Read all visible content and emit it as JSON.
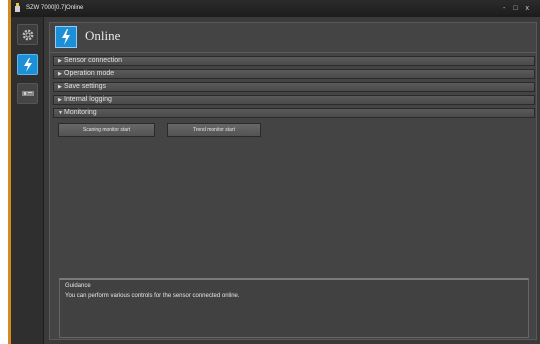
{
  "window": {
    "title": "SZW 7000[0.7]Online",
    "controls": [
      "-",
      "□",
      "x"
    ]
  },
  "rail": {
    "items": [
      {
        "name": "settings",
        "icon": "gear-icon"
      },
      {
        "name": "online",
        "icon": "lightning-icon",
        "active": true
      },
      {
        "name": "sensor",
        "icon": "sensor-device-icon"
      }
    ]
  },
  "header": {
    "title": "Online",
    "icon": "lightning-icon"
  },
  "sections": [
    {
      "label": "Sensor connection",
      "expanded": false
    },
    {
      "label": "Operation mode",
      "expanded": false
    },
    {
      "label": "Save settings",
      "expanded": false
    },
    {
      "label": "Internal logging",
      "expanded": false
    },
    {
      "label": "Monitoring",
      "expanded": true
    }
  ],
  "monitoring": {
    "scan_button": "Scaning monitor start",
    "trend_button": "Trend monitor start"
  },
  "guidance": {
    "heading": "Guidance",
    "text": "You can perform various controls for the sensor connected online."
  },
  "colors": {
    "accent": "#1d8fd6",
    "frame": "#d48a1e",
    "panel": "#444444"
  }
}
